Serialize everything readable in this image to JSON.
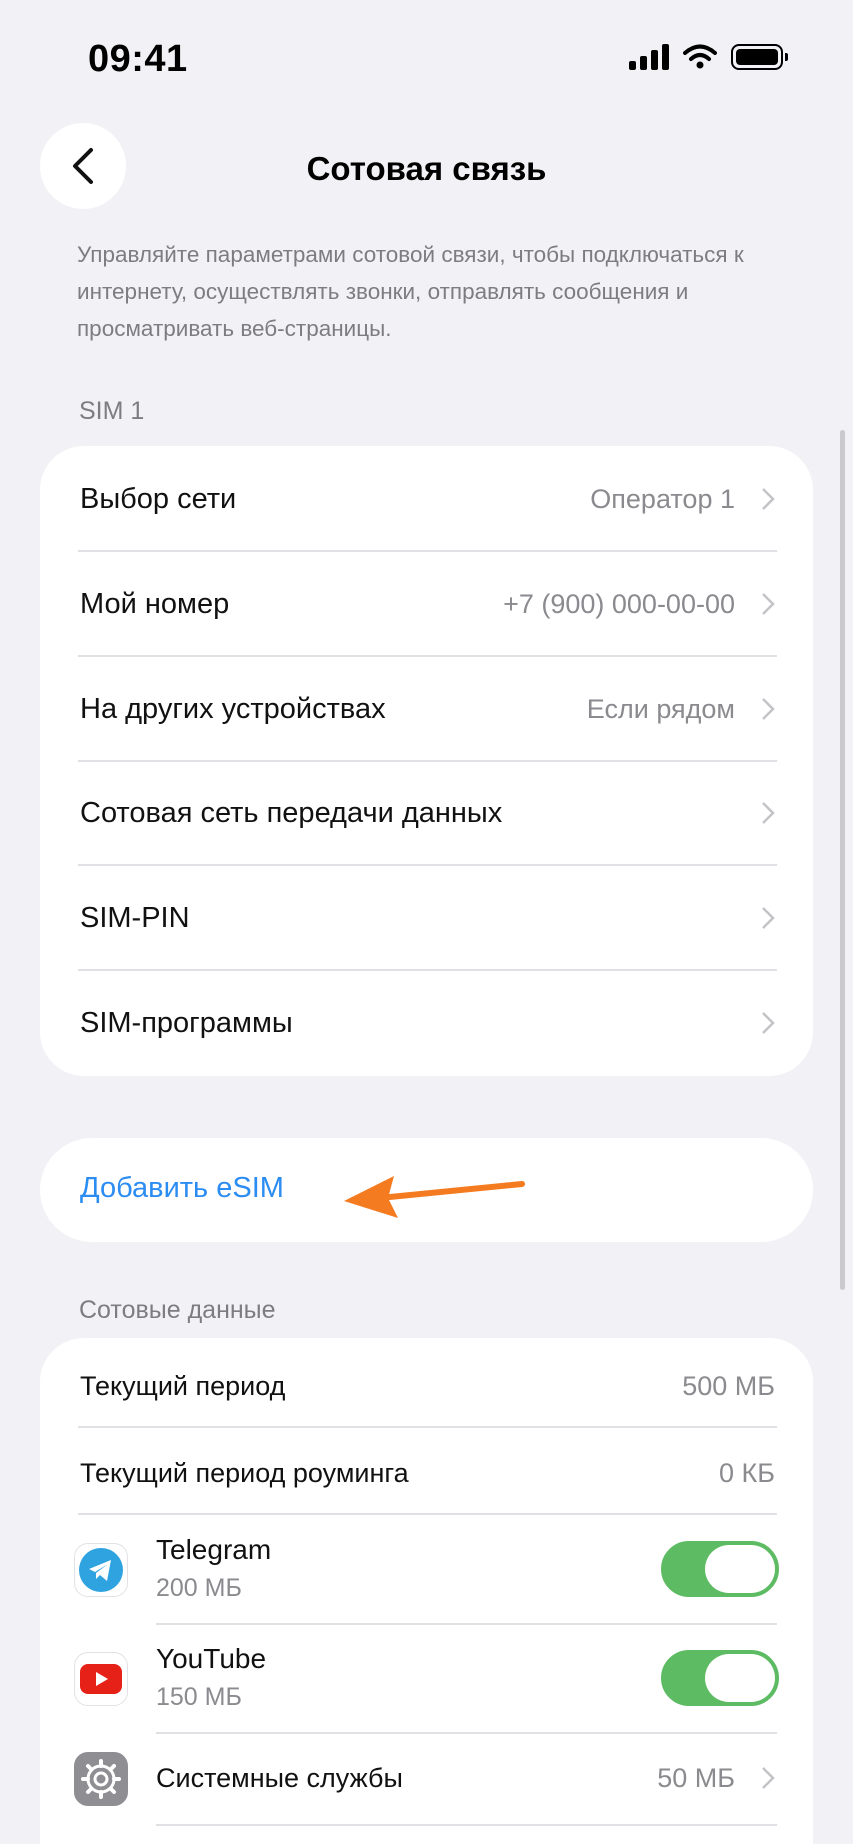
{
  "status_bar": {
    "time": "09:41"
  },
  "header": {
    "title": "Сотовая связь",
    "back_icon": "chevron-left-icon"
  },
  "description": "Управляйте параметрами сотовой связи, чтобы подключаться к интернету, осуществлять звонки, отправлять сообщения и просматривать веб-страницы.",
  "sim_section": {
    "label": "SIM 1",
    "rows": [
      {
        "label": "Выбор сети",
        "value": "Оператор 1"
      },
      {
        "label": "Мой номер",
        "value": "+7 (900) 000-00-00"
      },
      {
        "label": "На других устройствах",
        "value": "Если рядом"
      },
      {
        "label": "Сотовая сеть передачи данных",
        "value": ""
      },
      {
        "label": "SIM-PIN",
        "value": ""
      },
      {
        "label": "SIM-программы",
        "value": ""
      }
    ]
  },
  "add_esim": {
    "label": "Добавить eSIM"
  },
  "cellular_data": {
    "label": "Сотовые данные",
    "rows": [
      {
        "label": "Текущий период",
        "value": "500 МБ"
      },
      {
        "label": "Текущий период роуминга",
        "value": "0 КБ"
      }
    ],
    "apps": [
      {
        "name": "Telegram",
        "usage": "200 МБ",
        "icon": "telegram-icon",
        "enabled": true
      },
      {
        "name": "YouTube",
        "usage": "150 МБ",
        "icon": "youtube-icon",
        "enabled": true
      }
    ],
    "system": {
      "name": "Системные службы",
      "usage": "50 МБ",
      "icon": "gear-icon"
    }
  },
  "colors": {
    "accent": "#2b8cf2",
    "toggle_on": "#5dbb63",
    "annotation_arrow": "#f47b20"
  }
}
